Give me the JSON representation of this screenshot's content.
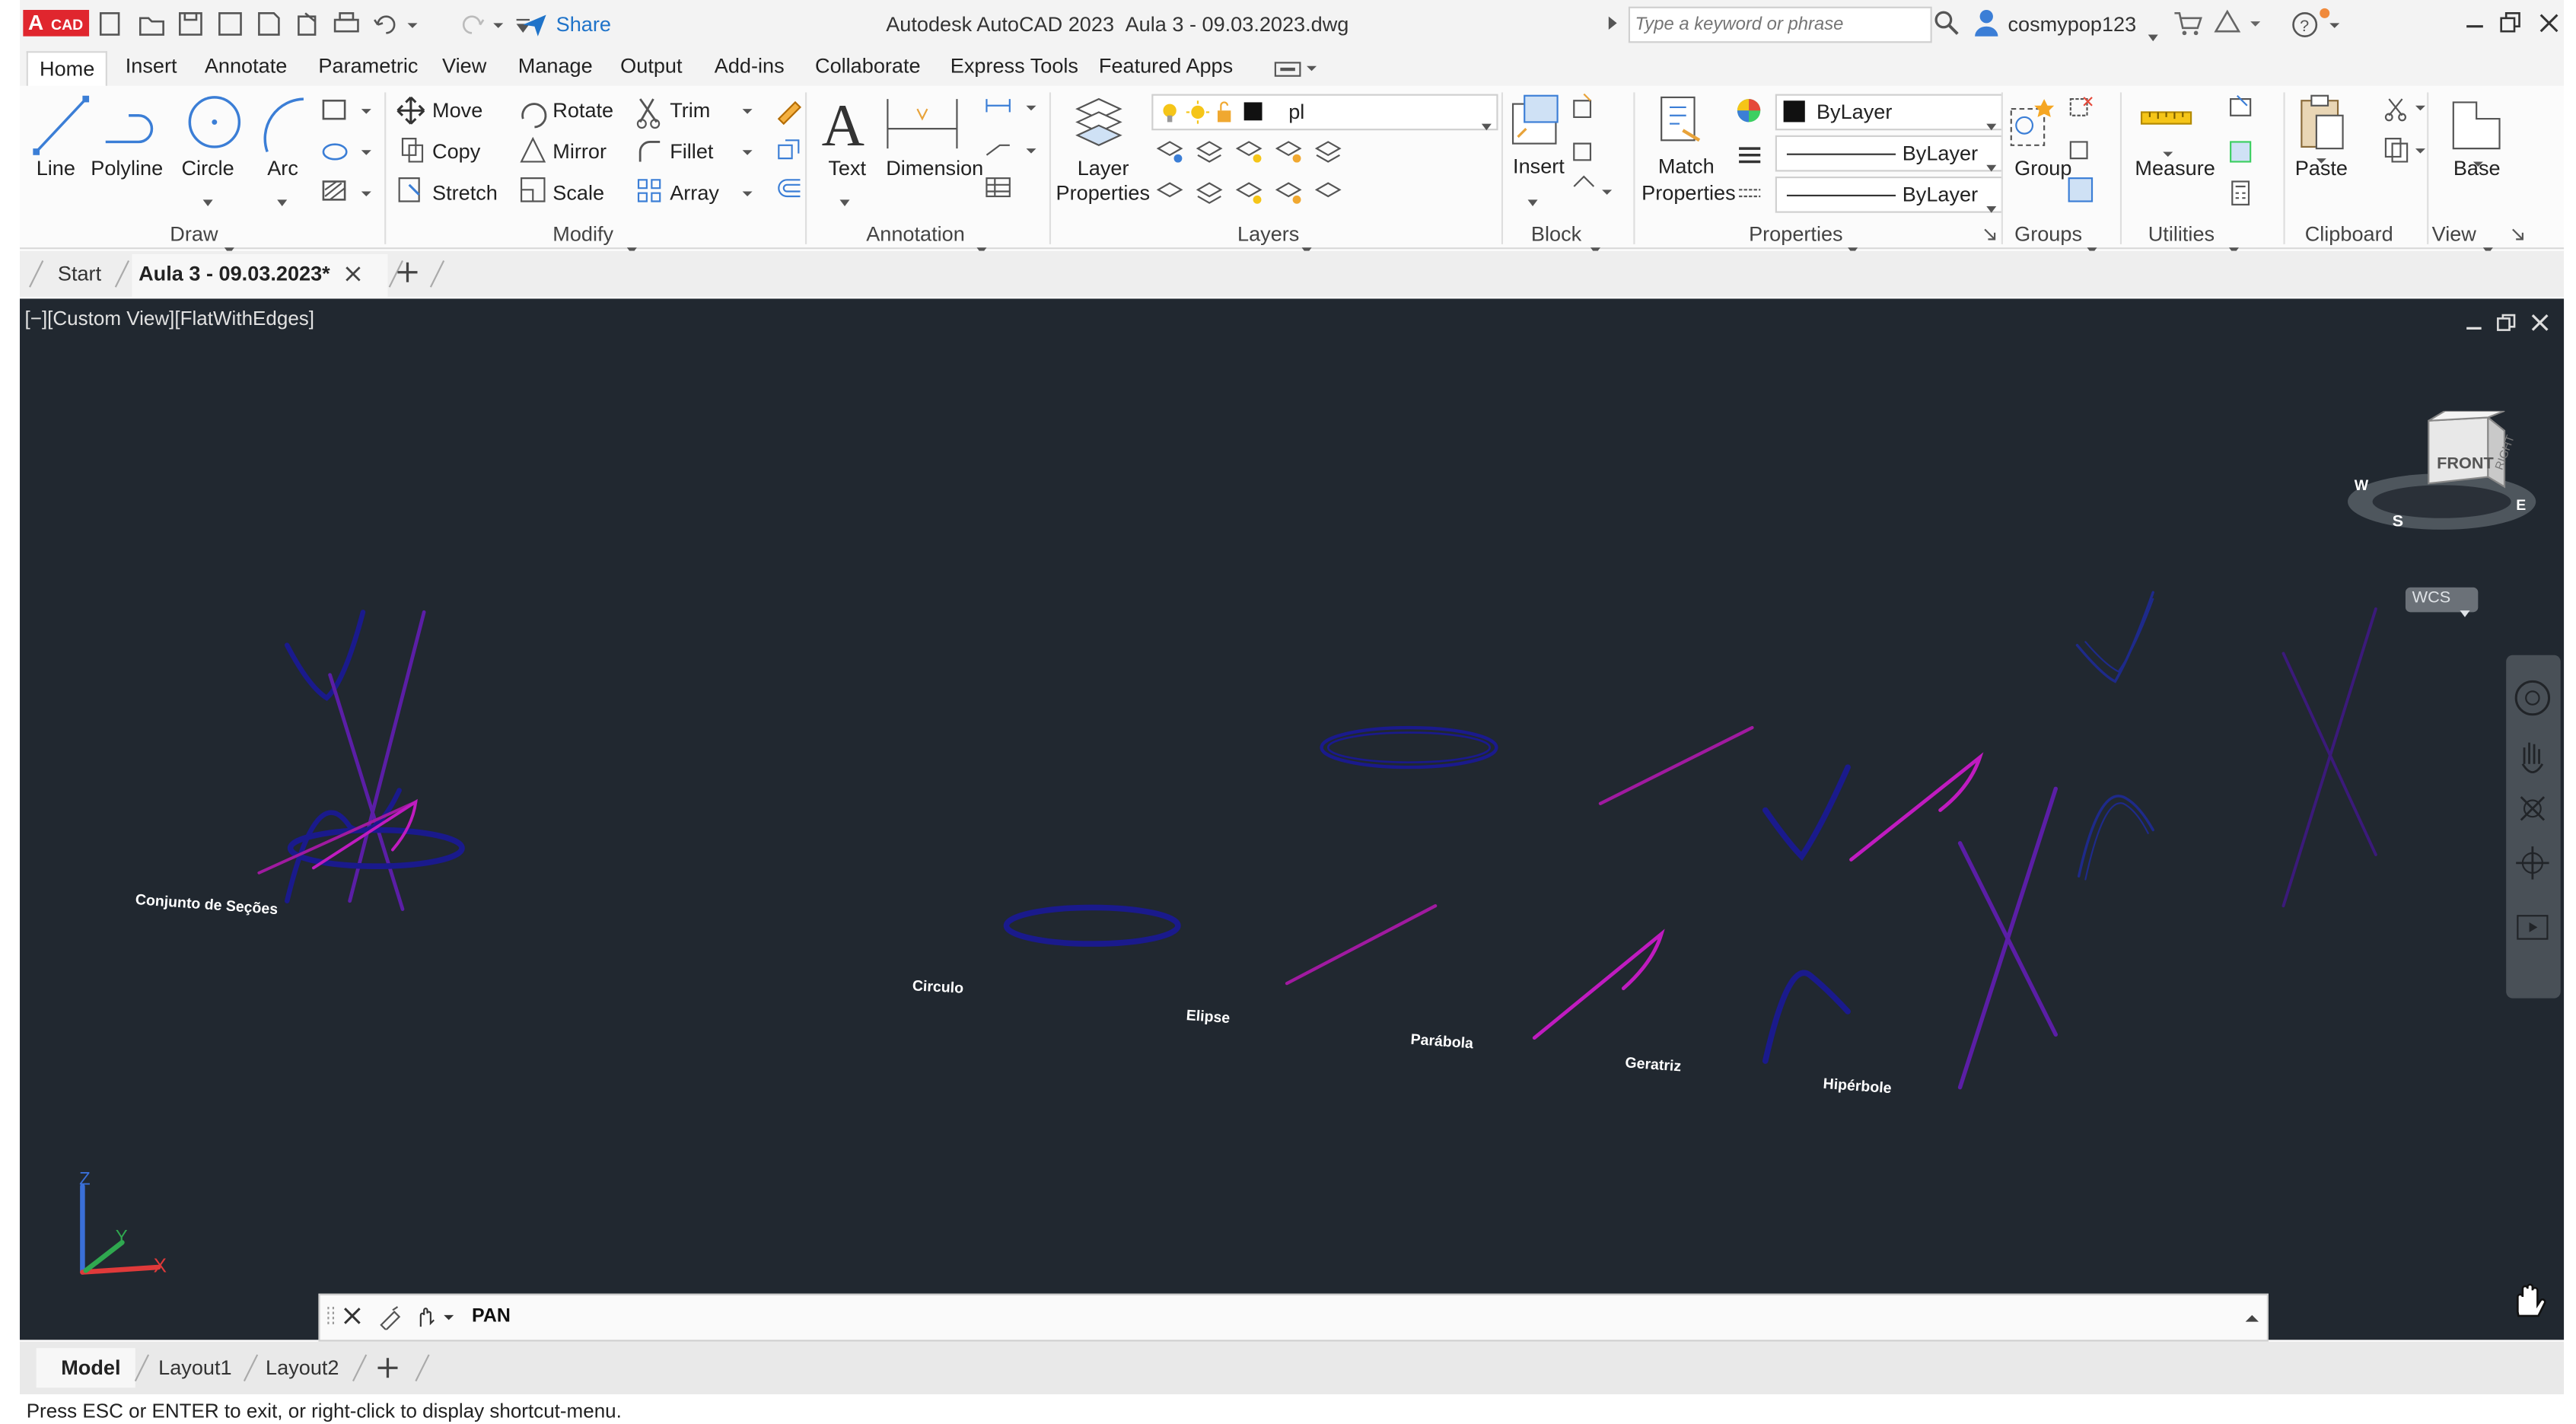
{
  "titlebar": {
    "app_badge": "CAD",
    "share_label": "Share",
    "app_title": "Autodesk AutoCAD 2023",
    "file_title": "Aula 3 - 09.03.2023.dwg",
    "search_placeholder": "Type a keyword or phrase",
    "username": "cosmypop123"
  },
  "ribbon_tabs": [
    "Home",
    "Insert",
    "Annotate",
    "Parametric",
    "View",
    "Manage",
    "Output",
    "Add-ins",
    "Collaborate",
    "Express Tools",
    "Featured Apps"
  ],
  "draw": {
    "line": "Line",
    "polyline": "Polyline",
    "circle": "Circle",
    "arc": "Arc",
    "title": "Draw"
  },
  "modify": {
    "move": "Move",
    "rotate": "Rotate",
    "trim": "Trim",
    "copy": "Copy",
    "mirror": "Mirror",
    "fillet": "Fillet",
    "stretch": "Stretch",
    "scale": "Scale",
    "array": "Array",
    "title": "Modify"
  },
  "annotation": {
    "text": "Text",
    "dimension": "Dimension",
    "title": "Annotation"
  },
  "layers": {
    "layer_properties_1": "Layer",
    "layer_properties_2": "Properties",
    "current_layer": "pl",
    "title": "Layers"
  },
  "block": {
    "insert": "Insert",
    "title": "Block"
  },
  "properties": {
    "match_1": "Match",
    "match_2": "Properties",
    "color": "ByLayer",
    "linetype": "ByLayer",
    "lineweight": "ByLayer",
    "title": "Properties"
  },
  "groups": {
    "group": "Group",
    "title": "Groups"
  },
  "utilities": {
    "measure": "Measure",
    "title": "Utilities"
  },
  "clipboard": {
    "paste": "Paste",
    "title": "Clipboard"
  },
  "view_panel": {
    "base": "Base",
    "title": "View"
  },
  "doc_tabs": {
    "start": "Start",
    "active": "Aula 3 - 09.03.2023*"
  },
  "viewport": {
    "label": "[−][Custom View][FlatWithEdges]",
    "viewcube_front": "FRONT",
    "viewcube_right": "RIGHT",
    "wcs": "WCS",
    "compass_w": "W",
    "compass_s": "S",
    "compass_e": "E",
    "ucs_z": "Z",
    "ucs_y": "Y",
    "ucs_x": "X",
    "labels": [
      "Conjunto de Seções",
      "Circulo",
      "Elipse",
      "Parábola",
      "Geratriz",
      "Hipérbole"
    ]
  },
  "command": {
    "text": "PAN"
  },
  "layout_tabs": [
    "Model",
    "Layout1",
    "Layout2"
  ],
  "status": "Press ESC or ENTER to exit, or right-click to display shortcut-menu.",
  "colors": {
    "viewport_bg": "#212830",
    "navy": "#1a1a8c",
    "purple": "#5b1ea6",
    "magenta": "#c01bc0",
    "brand_red": "#e0262e",
    "share_blue": "#1f73c9"
  }
}
